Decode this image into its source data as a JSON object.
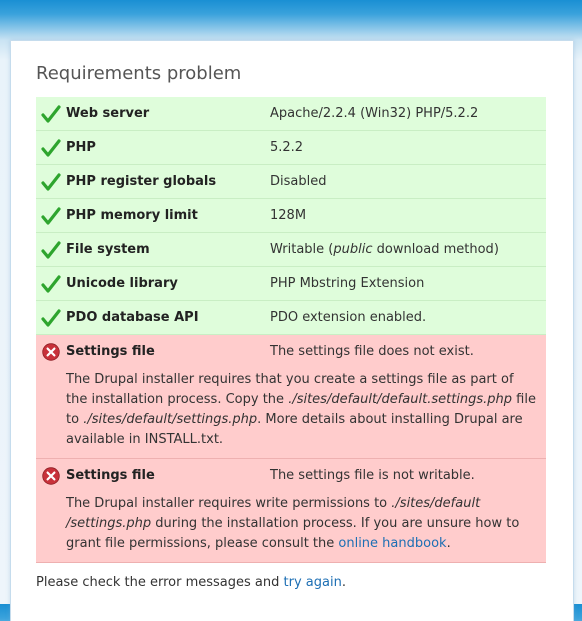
{
  "page": {
    "title": "Requirements problem"
  },
  "requirements": [
    {
      "status": "ok",
      "icon": "check-icon",
      "label": "Web server",
      "value": "Apache/2.2.4 (Win32) PHP/5.2.2"
    },
    {
      "status": "ok",
      "icon": "check-icon",
      "label": "PHP",
      "value": "5.2.2"
    },
    {
      "status": "ok",
      "icon": "check-icon",
      "label": "PHP register globals",
      "value": "Disabled"
    },
    {
      "status": "ok",
      "icon": "check-icon",
      "label": "PHP memory limit",
      "value": "128M"
    },
    {
      "status": "ok",
      "icon": "check-icon",
      "label": "File system",
      "value_prefix": "Writable (",
      "value_emphasis": "public",
      "value_suffix": " download method)"
    },
    {
      "status": "ok",
      "icon": "check-icon",
      "label": "Unicode library",
      "value": "PHP Mbstring Extension"
    },
    {
      "status": "ok",
      "icon": "check-icon",
      "label": "PDO database API",
      "value": "PDO extension enabled."
    }
  ],
  "errors": [
    {
      "icon": "error-icon",
      "label": "Settings file",
      "value": "The settings file does not exist.",
      "desc_1": "The Drupal installer requires that you create a settings file as part of the installation process. Copy the ",
      "desc_path_1": "./sites/default/default.settings.php",
      "desc_2": " file to ",
      "desc_path_2": "./sites/default/settings.php",
      "desc_3": ". More details about installing Drupal are available in INSTALL.txt."
    },
    {
      "icon": "error-icon",
      "label": "Settings file",
      "value": "The settings file is not writable.",
      "desc_1": "The Drupal installer requires write permissions to ",
      "desc_path_1": "./sites/default /settings.php",
      "desc_2": " during the installation process. If you are unsure how to grant file permissions, please consult the ",
      "desc_link": "online handbook",
      "desc_3": "."
    }
  ],
  "footer": {
    "text": "Please check the error messages and ",
    "link": "try again",
    "suffix": "."
  },
  "colors": {
    "ok_bg": "#dffddb",
    "error_bg": "#ffcccc",
    "check": "#2ea52e",
    "error_icon": "#c8313a",
    "link": "#1d6fb4"
  }
}
